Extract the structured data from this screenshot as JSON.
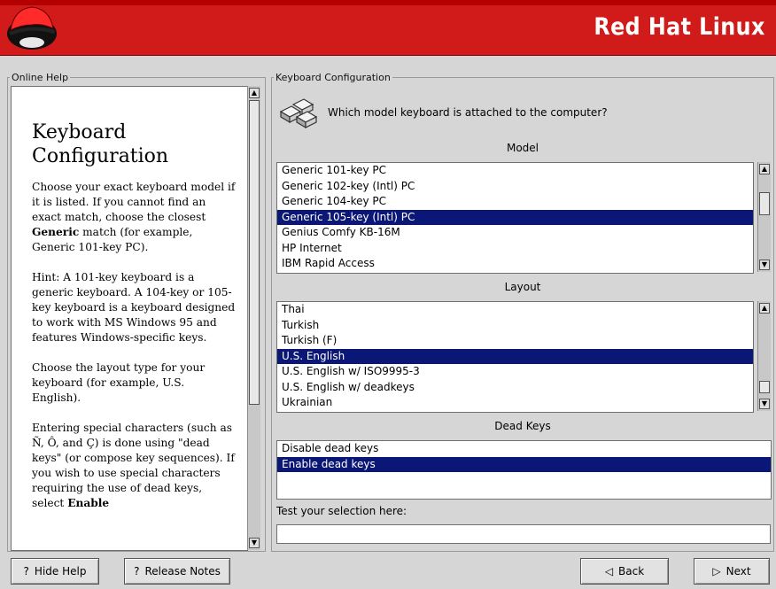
{
  "header": {
    "brand": "Red Hat Linux"
  },
  "help": {
    "frame_label": "Online Help",
    "title": "Keyboard Configuration",
    "p1_a": "Choose your exact keyboard model if it is listed. If you cannot find an exact match, choose the closest ",
    "p1_bold": "Generic",
    "p1_b": " match (for example, Generic 101-key PC).",
    "p2": "Hint: A 101-key keyboard is a generic keyboard. A 104-key or 105-key keyboard is a keyboard designed to work with MS Windows 95 and features Windows-specific keys.",
    "p3": "Choose the layout type for your keyboard (for example, U.S. English).",
    "p4_a": "Entering special characters (such as Ñ, Ô, and Ç) is done using \"dead keys\" (or compose key sequences). If you wish to use special characters requiring the use of dead keys, select ",
    "p4_bold": "Enable"
  },
  "keyboard": {
    "frame_label": "Keyboard Configuration",
    "question": "Which model keyboard is attached to the computer?",
    "model_label": "Model",
    "models": [
      "Generic 101-key PC",
      "Generic 102-key (Intl) PC",
      "Generic 104-key PC",
      "Generic 105-key (Intl) PC",
      "Genius Comfy KB-16M",
      "HP Internet",
      "IBM Rapid Access"
    ],
    "model_selected": 3,
    "layout_label": "Layout",
    "layouts": [
      "Thai",
      "Turkish",
      "Turkish (F)",
      "U.S. English",
      "U.S. English w/ ISO9995-3",
      "U.S. English w/ deadkeys",
      "Ukrainian"
    ],
    "layout_selected": 3,
    "deadkeys_label": "Dead Keys",
    "deadkeys": [
      "Disable dead keys",
      "Enable dead keys"
    ],
    "deadkeys_selected": 1,
    "test_label": "Test your selection here:",
    "test_value": ""
  },
  "buttons": {
    "hide_help": "Hide Help",
    "release_notes": "Release Notes",
    "back": "Back",
    "next": "Next"
  },
  "colors": {
    "brand_red": "#d11a1a",
    "selection": "#0b1776",
    "background": "#d6d6d6"
  },
  "icons": {
    "logo": "shadowman-logo-icon",
    "keyboard": "keyboard-keys-icon",
    "help": "question-mark-icon",
    "back": "back-arrow-icon",
    "next": "next-arrow-icon"
  }
}
